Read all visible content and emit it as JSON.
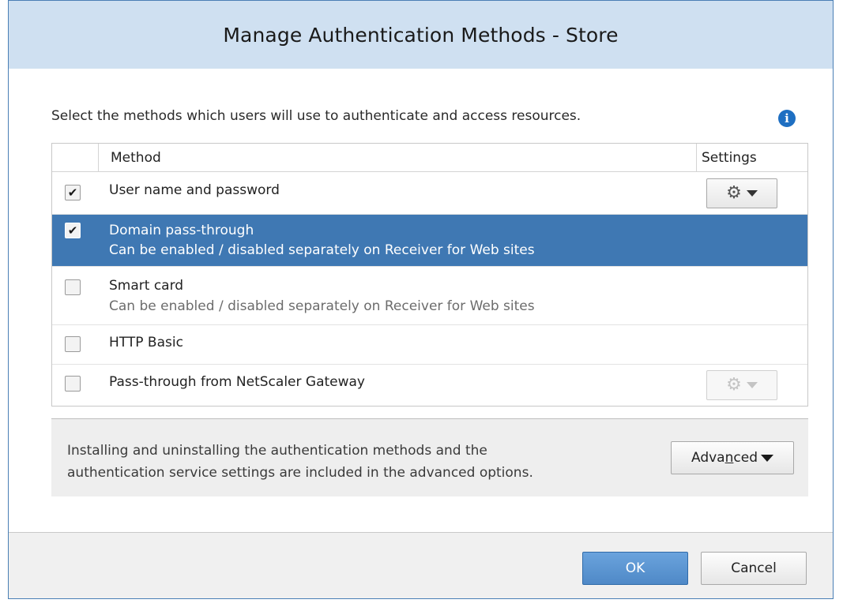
{
  "dialog": {
    "title": "Manage Authentication Methods - Store",
    "instruction": "Select the methods which users will use to authenticate and access resources.",
    "info_icon": "info-icon"
  },
  "table": {
    "columns": {
      "method": "Method",
      "settings": "Settings"
    },
    "rows": [
      {
        "name": "User name and password",
        "description": "",
        "checked": true,
        "selected": false,
        "settings": "enabled"
      },
      {
        "name": "Domain pass-through",
        "description": "Can be enabled / disabled separately on Receiver for Web sites",
        "checked": true,
        "selected": true,
        "settings": "none"
      },
      {
        "name": "Smart card",
        "description": "Can be enabled / disabled separately on Receiver for Web sites",
        "checked": false,
        "selected": false,
        "settings": "none"
      },
      {
        "name": "HTTP Basic",
        "description": "",
        "checked": false,
        "selected": false,
        "settings": "none"
      },
      {
        "name": "Pass-through from NetScaler Gateway",
        "description": "",
        "checked": false,
        "selected": false,
        "settings": "disabled"
      }
    ]
  },
  "advanced": {
    "text_line1": "Installing and uninstalling the authentication methods and the",
    "text_line2": "authentication service settings are included in the advanced options.",
    "button_pre": "Adva",
    "button_access_key": "n",
    "button_post": "ced"
  },
  "footer": {
    "ok_label": "OK",
    "cancel_label": "Cancel"
  },
  "colors": {
    "title_bar": "#cfe0f1",
    "selected_row": "#3f78b3",
    "ok_button": "#5a92d0",
    "info_icon": "#1e6fc2"
  }
}
